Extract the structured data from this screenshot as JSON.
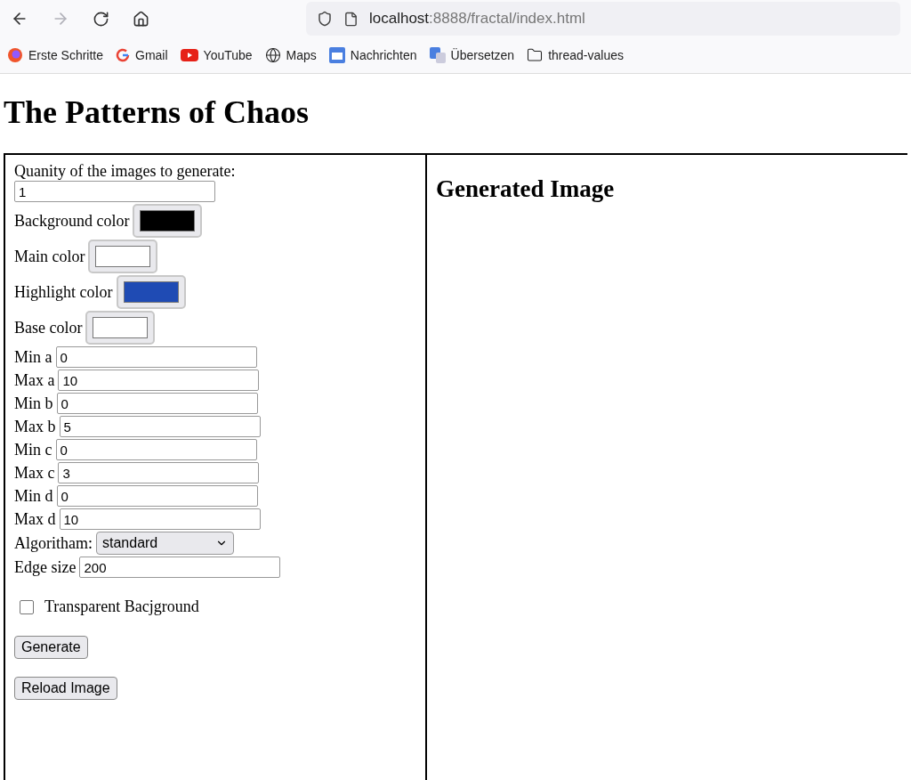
{
  "browser": {
    "url_host": "localhost",
    "url_path": ":8888/fractal/index.html",
    "bookmarks": [
      {
        "kind": "firefox",
        "label": "Erste Schritte"
      },
      {
        "kind": "google",
        "label": "Gmail"
      },
      {
        "kind": "youtube",
        "label": "YouTube"
      },
      {
        "kind": "globe",
        "label": "Maps"
      },
      {
        "kind": "news",
        "label": "Nachrichten"
      },
      {
        "kind": "translate",
        "label": "Übersetzen"
      },
      {
        "kind": "folder",
        "label": "thread-values"
      }
    ]
  },
  "page": {
    "title": "The Patterns of Chaos",
    "form": [
      {
        "kind": "stacked",
        "label": "Quanity of the images to generate:",
        "value": "1"
      },
      {
        "kind": "color",
        "label": "Background color",
        "color": "#000000"
      },
      {
        "kind": "color",
        "label": "Main color",
        "color": "#ffffff"
      },
      {
        "kind": "color",
        "label": "Highlight color",
        "color": "#1f4bb4"
      },
      {
        "kind": "color",
        "label": "Base color",
        "color": "#ffffff"
      },
      {
        "kind": "text",
        "label": "Min a",
        "value": "0"
      },
      {
        "kind": "text",
        "label": "Max a",
        "value": "10"
      },
      {
        "kind": "text",
        "label": "Min b",
        "value": "0"
      },
      {
        "kind": "text",
        "label": "Max b",
        "value": "5"
      },
      {
        "kind": "text",
        "label": "Min c",
        "value": "0"
      },
      {
        "kind": "text",
        "label": "Max c",
        "value": "3"
      },
      {
        "kind": "text",
        "label": "Min d",
        "value": "0"
      },
      {
        "kind": "text",
        "label": "Max d",
        "value": "10"
      },
      {
        "kind": "select",
        "label": "Algoritham:",
        "value": "standard"
      },
      {
        "kind": "text",
        "label": "Edge size",
        "value": "200"
      },
      {
        "kind": "checkbox",
        "label": "Transparent Bacjground",
        "checked": false
      },
      {
        "kind": "button",
        "label": "Generate"
      },
      {
        "kind": "button",
        "label": "Reload Image"
      }
    ],
    "result_heading": "Generated Image"
  }
}
